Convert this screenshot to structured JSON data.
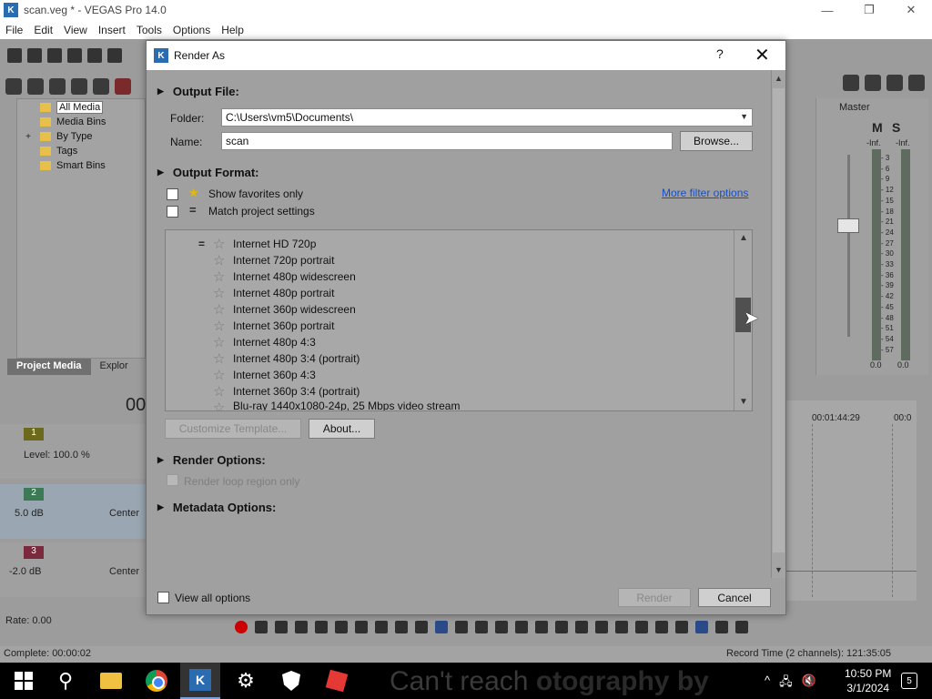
{
  "app": {
    "title": "scan.veg * - VEGAS Pro 14.0",
    "logo": "K",
    "window_controls": [
      "—",
      "❐",
      "✕"
    ],
    "menu": [
      "File",
      "Edit",
      "View",
      "Insert",
      "Tools",
      "Options",
      "Help"
    ]
  },
  "project_media": {
    "tree": [
      {
        "label": "All Media",
        "expandable": false,
        "selected": true
      },
      {
        "label": "Media Bins",
        "expandable": false
      },
      {
        "label": "By Type",
        "expandable": true
      },
      {
        "label": "Tags",
        "expandable": false
      },
      {
        "label": "Smart Bins",
        "expandable": false
      }
    ],
    "tabs": [
      "Project Media",
      "Explor"
    ]
  },
  "timeline": {
    "timecode": "00",
    "track1": {
      "num": "1",
      "level": "Level: 100.0 %"
    },
    "track2": {
      "num": "2",
      "volume": "5.0 dB",
      "pan": "Center"
    },
    "track3": {
      "num": "3",
      "volume": "-2.0 dB",
      "pan": "Center"
    },
    "ruler_times": [
      "00:01:44:29",
      "00:0"
    ],
    "rate": "Rate: 0.00",
    "complete": "Complete: 00:00:02",
    "record_time": "Record Time (2 channels): 121:35:05"
  },
  "mixer": {
    "label": "Master",
    "m_label": "M",
    "s_label": "S",
    "inf_left": "-Inf.",
    "inf_right": "-Inf.",
    "scale": [
      "3",
      "6",
      "9",
      "12",
      "15",
      "18",
      "21",
      "24",
      "27",
      "30",
      "33",
      "36",
      "39",
      "42",
      "45",
      "48",
      "51",
      "54",
      "57"
    ],
    "val_left": "0.0",
    "val_right": "0.0"
  },
  "dialog": {
    "title": "Render As",
    "help": "?",
    "close": "✕",
    "output_file": {
      "heading": "Output File:",
      "folder_label": "Folder:",
      "folder_value": "C:\\Users\\vm5\\Documents\\",
      "name_label": "Name:",
      "name_value": "scan",
      "browse": "Browse..."
    },
    "output_format": {
      "heading": "Output Format:",
      "show_favorites": "Show favorites only",
      "match_project": "Match project settings",
      "more_filter": "More filter options",
      "templates": [
        {
          "label": "Internet HD 720p",
          "match": true
        },
        {
          "label": "Internet 720p portrait"
        },
        {
          "label": "Internet 480p widescreen"
        },
        {
          "label": "Internet 480p portrait"
        },
        {
          "label": "Internet 360p widescreen"
        },
        {
          "label": "Internet 360p portrait"
        },
        {
          "label": "Internet 480p 4:3"
        },
        {
          "label": "Internet 480p 3:4 (portrait)"
        },
        {
          "label": "Internet 360p 4:3"
        },
        {
          "label": "Internet 360p 3:4 (portrait)"
        },
        {
          "label": "Blu-ray 1440x1080-24p, 25 Mbps video stream"
        }
      ],
      "customize": "Customize Template...",
      "about": "About..."
    },
    "render_options": {
      "heading": "Render Options:",
      "loop_region": "Render loop region only"
    },
    "metadata": {
      "heading": "Metadata Options:"
    },
    "view_all": "View all options",
    "render_btn": "Render",
    "cancel_btn": "Cancel"
  },
  "taskbar": {
    "faded_text_1": "Can't reach",
    "faded_text_2": "otography by",
    "time": "10:50 PM",
    "date": "3/1/2024",
    "notifications": "5"
  }
}
